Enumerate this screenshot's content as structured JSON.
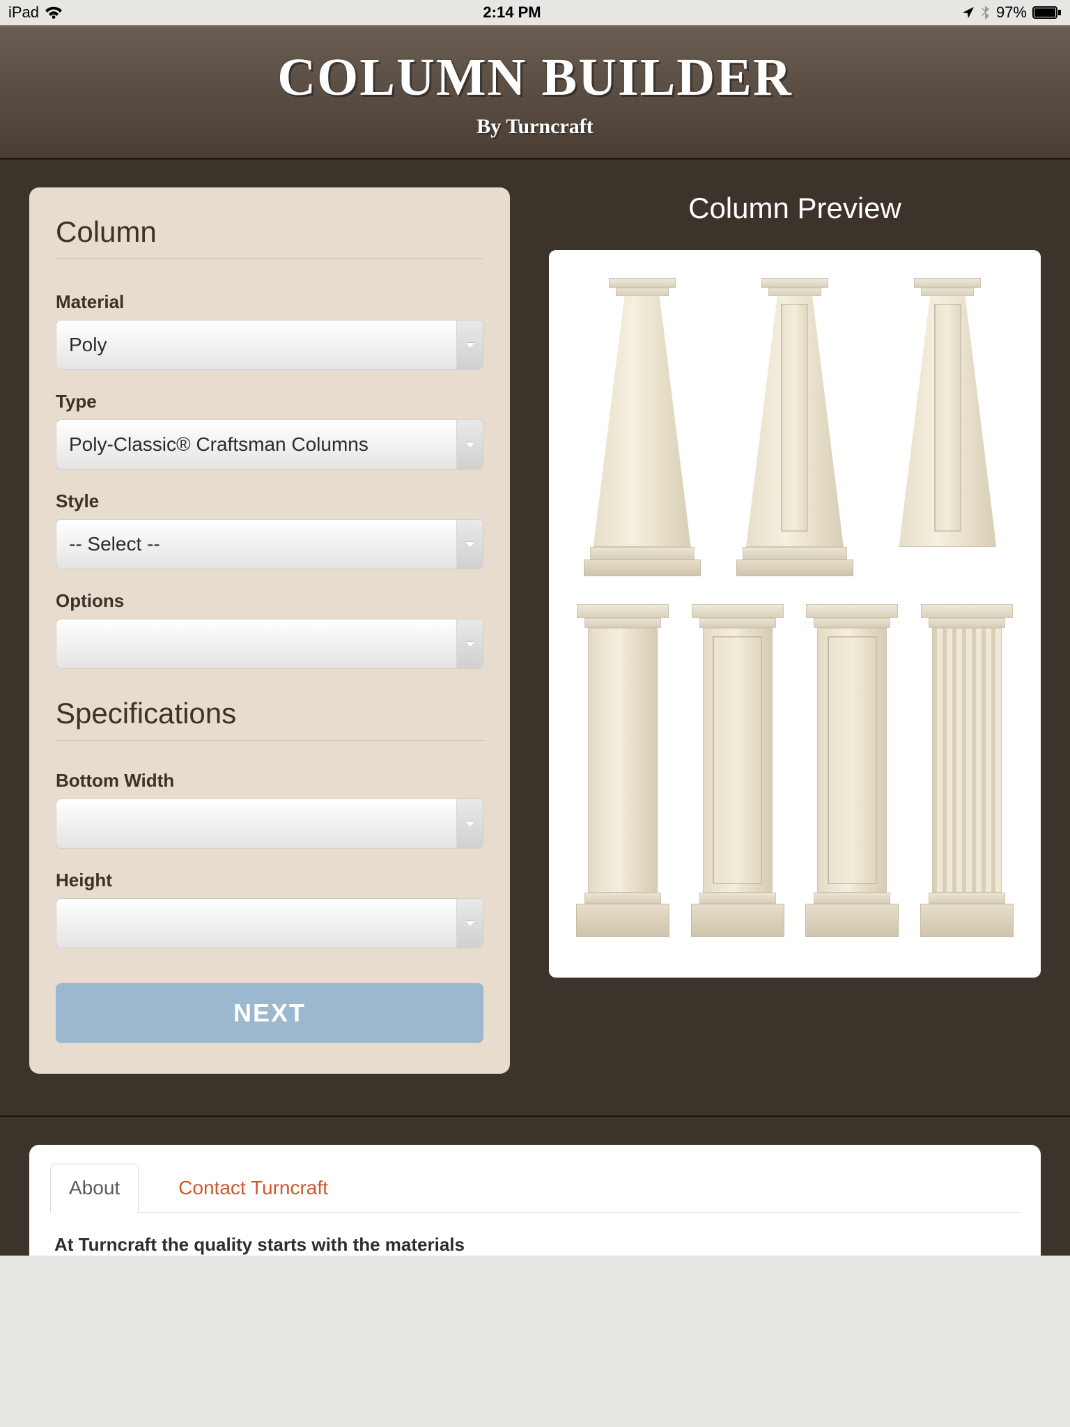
{
  "statusbar": {
    "device": "iPad",
    "time": "2:14 PM",
    "battery": "97%"
  },
  "header": {
    "title": "COLUMN BUILDER",
    "subtitle": "By Turncraft"
  },
  "form": {
    "section_column": "Column",
    "material_label": "Material",
    "material_value": "Poly",
    "type_label": "Type",
    "type_value": "Poly-Classic® Craftsman Columns",
    "style_label": "Style",
    "style_value": "-- Select --",
    "options_label": "Options",
    "options_value": "",
    "section_specs": "Specifications",
    "bottomwidth_label": "Bottom Width",
    "bottomwidth_value": "",
    "height_label": "Height",
    "height_value": "",
    "next_label": "NEXT"
  },
  "preview": {
    "title": "Column Preview"
  },
  "tabs": {
    "about": "About",
    "contact": "Contact Turncraft"
  },
  "bottom_text": "At Turncraft the quality starts with the materials"
}
